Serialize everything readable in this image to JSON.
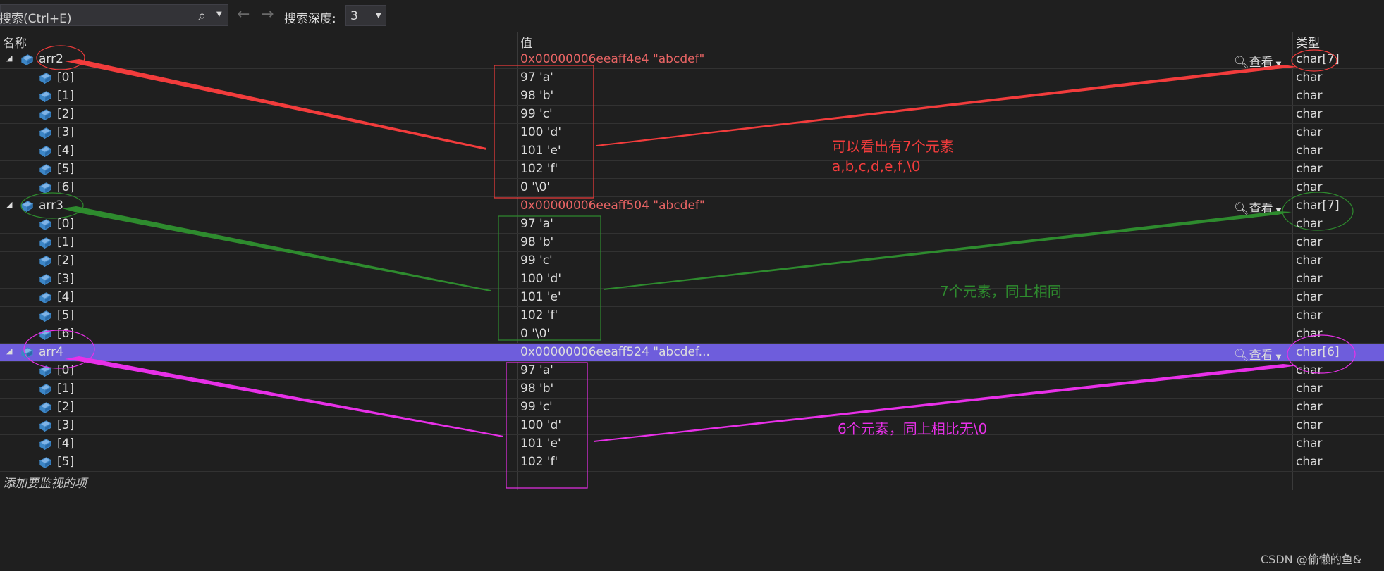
{
  "toolbar": {
    "search_placeholder": "搜索(Ctrl+E)",
    "search_icon": "search-icon",
    "back_glyph": "←",
    "forward_glyph": "→",
    "depth_label": "搜索深度:",
    "depth_value": "3"
  },
  "columns": {
    "name": "名称",
    "value": "值",
    "type": "类型"
  },
  "view_label": "查看",
  "rows": [
    {
      "name": "arr2",
      "value": "0x00000006eeaff4e4 \"abcdef\"",
      "type": "char[7]",
      "parent": true
    },
    {
      "name": "[0]",
      "value": "97 'a'",
      "type": "char"
    },
    {
      "name": "[1]",
      "value": "98 'b'",
      "type": "char"
    },
    {
      "name": "[2]",
      "value": "99 'c'",
      "type": "char"
    },
    {
      "name": "[3]",
      "value": "100 'd'",
      "type": "char"
    },
    {
      "name": "[4]",
      "value": "101 'e'",
      "type": "char"
    },
    {
      "name": "[5]",
      "value": "102 'f'",
      "type": "char"
    },
    {
      "name": "[6]",
      "value": "0 '\\0'",
      "type": "char"
    },
    {
      "name": "arr3",
      "value": "0x00000006eeaff504 \"abcdef\"",
      "type": "char[7]",
      "parent": true
    },
    {
      "name": "[0]",
      "value": "97 'a'",
      "type": "char"
    },
    {
      "name": "[1]",
      "value": "98 'b'",
      "type": "char"
    },
    {
      "name": "[2]",
      "value": "99 'c'",
      "type": "char"
    },
    {
      "name": "[3]",
      "value": "100 'd'",
      "type": "char"
    },
    {
      "name": "[4]",
      "value": "101 'e'",
      "type": "char"
    },
    {
      "name": "[5]",
      "value": "102 'f'",
      "type": "char"
    },
    {
      "name": "[6]",
      "value": "0 '\\0'",
      "type": "char"
    },
    {
      "name": "arr4",
      "value": "0x00000006eeaff524 \"abcdef...",
      "type": "char[6]",
      "parent": true,
      "selected": true
    },
    {
      "name": "[0]",
      "value": "97 'a'",
      "type": "char"
    },
    {
      "name": "[1]",
      "value": "98 'b'",
      "type": "char"
    },
    {
      "name": "[2]",
      "value": "99 'c'",
      "type": "char"
    },
    {
      "name": "[3]",
      "value": "100 'd'",
      "type": "char"
    },
    {
      "name": "[4]",
      "value": "101 'e'",
      "type": "char"
    },
    {
      "name": "[5]",
      "value": "102 'f'",
      "type": "char"
    }
  ],
  "add_watch": "添加要监视的项",
  "annotations": {
    "red_note_line1": "可以看出有7个元素",
    "red_note_line2": "a,b,c,d,e,f,\\0",
    "green_note": "7个元素，同上相同",
    "magenta_note": "6个元素，同上相比无\\0"
  },
  "credit": "CSDN @偷懒的鱼&",
  "colors": {
    "red": "#f23c3c",
    "green": "#2e8b2e",
    "magenta": "#e830e8",
    "selection": "#6e5ddc",
    "value_red": "#e86464"
  }
}
